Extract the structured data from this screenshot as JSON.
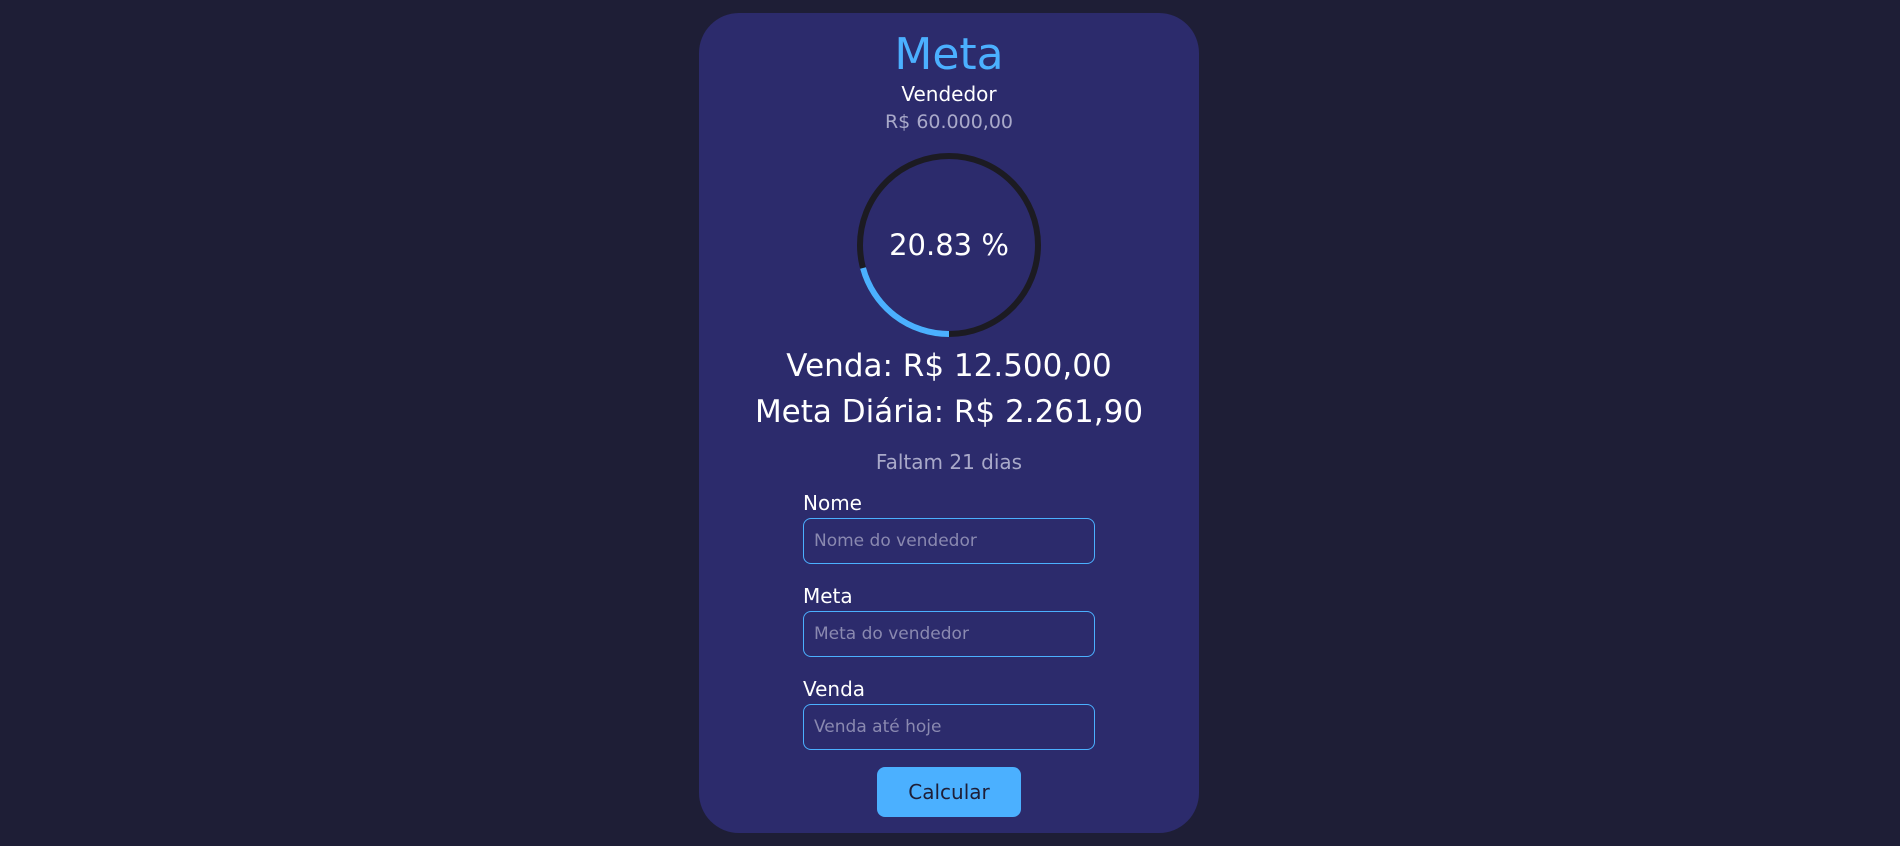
{
  "card": {
    "title": "Meta",
    "seller_label": "Vendedor",
    "goal_value": "R$ 60.000,00"
  },
  "progress": {
    "percent_text": "20.83 %",
    "fraction": 0.2083,
    "track_color": "#1c1b22",
    "fill_color": "#4bb0ff"
  },
  "summary": {
    "sale": "Venda: R$ 12.500,00",
    "daily_goal": "Meta Diária: R$ 2.261,90",
    "remaining": "Faltam 21 dias"
  },
  "form": {
    "name_label": "Nome",
    "name_placeholder": "Nome do vendedor",
    "name_value": "",
    "goal_label": "Meta",
    "goal_placeholder": "Meta do vendedor",
    "goal_value": "",
    "sale_label": "Venda",
    "sale_placeholder": "Venda até hoje",
    "sale_value": "",
    "submit_label": "Calcular"
  },
  "colors": {
    "background": "#1e1e36",
    "card": "#2c2b6c",
    "accent": "#4bb0ff"
  }
}
